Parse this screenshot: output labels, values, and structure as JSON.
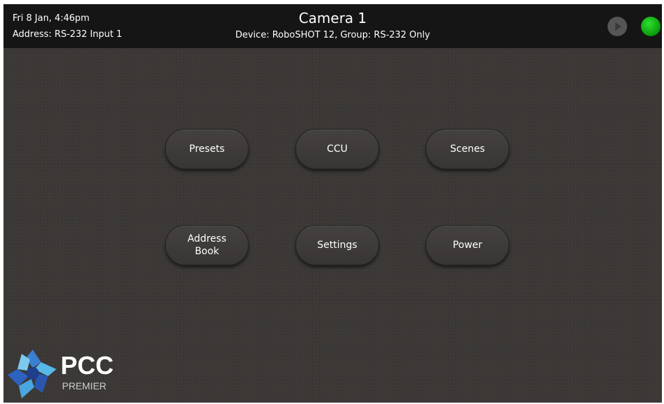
{
  "header": {
    "datetime": "Fri 8 Jan, 4:46pm",
    "address": "Address: RS-232 Input 1",
    "title": "Camera 1",
    "device": "Device: RoboSHOT 12, Group: RS-232 Only",
    "play_icon": "play-icon",
    "status_color": "#12b812"
  },
  "menu": {
    "presets": "Presets",
    "ccu": "CCU",
    "scenes": "Scenes",
    "address_book": "Address\nBook",
    "settings": "Settings",
    "power": "Power"
  },
  "logo": {
    "word": "PCC",
    "sub": "PREMIER"
  }
}
